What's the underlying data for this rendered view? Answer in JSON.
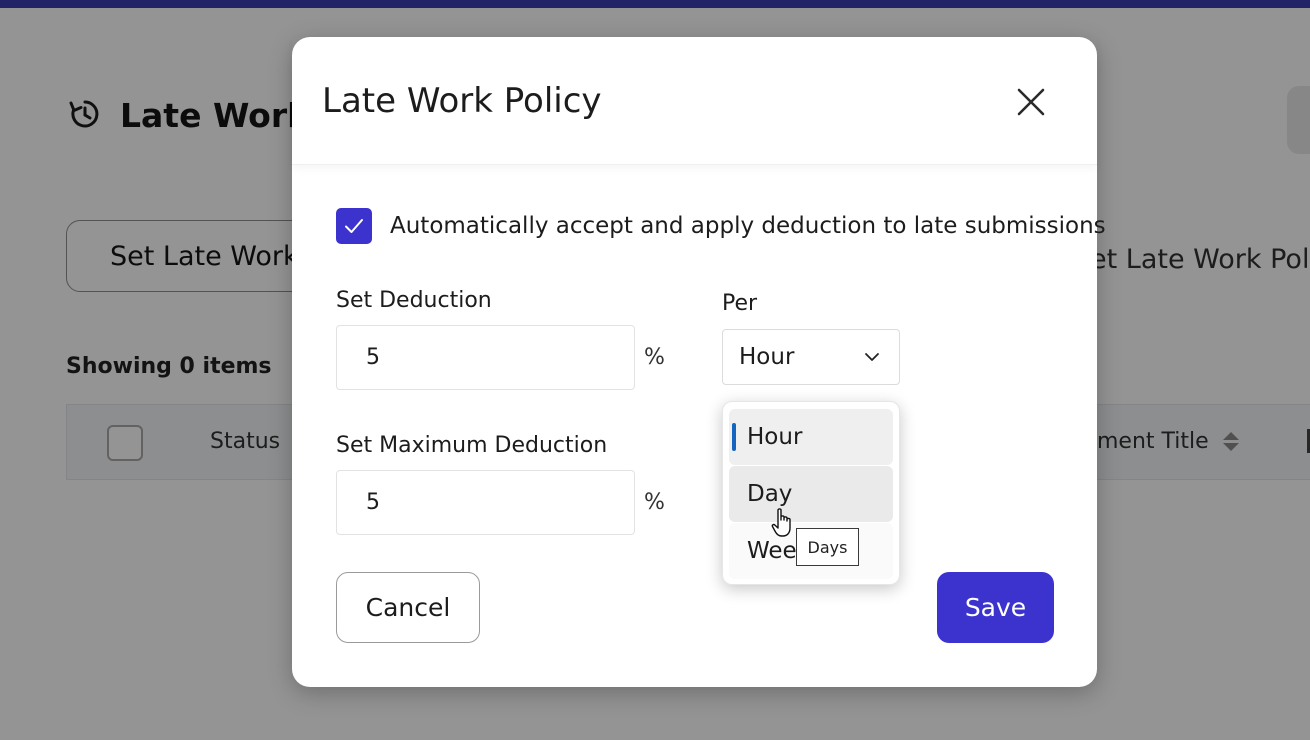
{
  "background": {
    "page_title": "Late Work",
    "set_button_label": "Set Late Work",
    "right_link_label": "et Late Work Polic",
    "showing_text": "Showing 0 items",
    "table": {
      "col_status": "Status",
      "col_assignment": "ment Title"
    }
  },
  "modal": {
    "title": "Late Work Policy",
    "auto_accept": {
      "checked": true,
      "label": "Automatically accept and apply deduction to late submissions"
    },
    "deduction": {
      "label": "Set Deduction",
      "value": "5",
      "unit": "%"
    },
    "per": {
      "label": "Per",
      "selected": "Hour",
      "options": [
        "Hour",
        "Day",
        "Wee"
      ]
    },
    "max_deduction": {
      "label": "Set Maximum Deduction",
      "value": "5",
      "unit": "%"
    },
    "tooltip": "Days",
    "cancel_label": "Cancel",
    "save_label": "Save"
  },
  "colors": {
    "accent": "#3c33cf",
    "top_bar": "#3a3fb0",
    "selected_indicator": "#1565c0",
    "overlay": "rgba(0,0,0,0.42)"
  },
  "icons": {
    "title_icon": "history-clock-icon",
    "close": "close-icon",
    "check": "check-icon",
    "select_chevron": "chevron-down-icon",
    "sort": "sort-icon",
    "cursor": "hand-pointer-icon"
  }
}
